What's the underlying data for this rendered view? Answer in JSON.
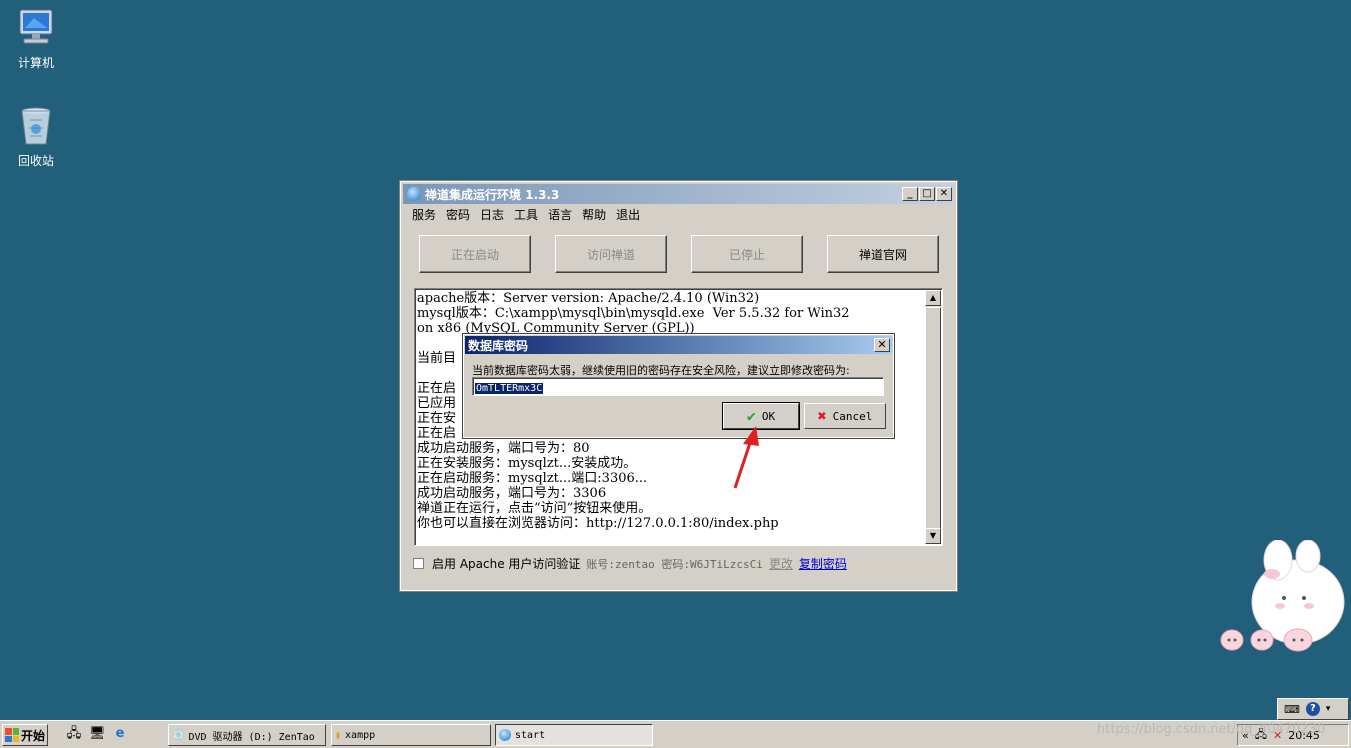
{
  "desktop": {
    "icons": [
      {
        "label": "计算机",
        "icon": "computer-icon"
      },
      {
        "label": "回收站",
        "icon": "recycle-bin-icon"
      }
    ]
  },
  "window": {
    "title": "禅道集成运行环境 1.3.3",
    "menu": [
      "服务",
      "密码",
      "日志",
      "工具",
      "语言",
      "帮助",
      "退出"
    ],
    "buttons": [
      {
        "label": "正在启动",
        "enabled": false
      },
      {
        "label": "访问禅道",
        "enabled": false
      },
      {
        "label": "已停止",
        "enabled": false
      },
      {
        "label": "禅道官网",
        "enabled": true
      }
    ],
    "log_lines": [
      "apache版本：Server version: Apache/2.4.10 (Win32)",
      "mysql版本：C:\\xampp\\mysql\\bin\\mysqld.exe  Ver 5.5.32 for Win32",
      "on x86 (MySQL Community Server (GPL))",
      "",
      "当前目",
      "",
      "正在启",
      "已应用",
      "正在安",
      "正在启",
      "成功启动服务，端口号为：80",
      "正在安装服务：mysqlzt...安装成功。",
      "正在启动服务：mysqlzt...端口:3306...",
      "成功启动服务，端口号为：3306",
      "禅道正在运行，点击“访问”按钮来使用。",
      "你也可以直接在浏览器访问：http://127.0.0.1:80/index.php"
    ],
    "auth_checkbox_label": "启用 Apache 用户访问验证",
    "account_text": "账号:zentao 密码:W6JTiLzcsCi",
    "change_link": "更改",
    "copy_password_link": "复制密码"
  },
  "dialog": {
    "title": "数据库密码",
    "message": "当前数据库密码太弱，继续使用旧的密码存在安全风险，建议立即修改密码为:",
    "password_value": "OmTLTERmx3C",
    "ok_label": "OK",
    "cancel_label": "Cancel"
  },
  "taskbar": {
    "start_label": "开始",
    "tasks": [
      {
        "label": "DVD 驱动器 (D:) ZenTao",
        "active": false
      },
      {
        "label": "xampp",
        "active": false
      },
      {
        "label": "start",
        "active": true
      }
    ],
    "clock": "20:45"
  },
  "watermark": "https://blog.csdn.net/qq_40470230",
  "colors": {
    "desktop": "#215f7a",
    "dialog_title": "#0a246a",
    "arrow": "#e02020"
  }
}
